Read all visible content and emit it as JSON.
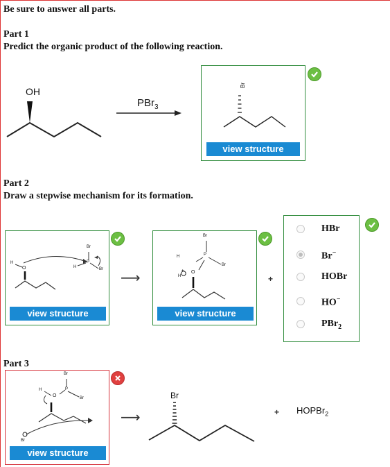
{
  "instruction": "Be sure to answer all parts.",
  "part1": {
    "heading": "Part 1",
    "prompt": "Predict the organic product of the following reaction.",
    "reactant_label": "OH",
    "reagent_prefix": "PBr",
    "reagent_sub": "3",
    "answer_atom_label": "Br",
    "button": "view structure",
    "status": "correct"
  },
  "part2": {
    "heading": "Part 2",
    "prompt": "Draw a stepwise mechanism for its formation.",
    "step1": {
      "button": "view structure",
      "status": "correct",
      "labels": {
        "h": "H",
        "o": "O",
        "br": "Br",
        "p": "P",
        "br2": "Br",
        "h2": "H"
      }
    },
    "step2": {
      "button": "view structure",
      "status": "correct",
      "labels": {
        "br_top": "Br",
        "h": "H",
        "p": "P",
        "br": "Br",
        "o": "O",
        "h2": "H",
        "charge": "+"
      }
    },
    "plus": "+",
    "options": [
      {
        "label": "HBr",
        "sup": "",
        "sub": "",
        "selected": false
      },
      {
        "label": "Br",
        "sup": "−",
        "sub": "",
        "selected": true
      },
      {
        "label": "HOBr",
        "sup": "",
        "sub": "",
        "selected": false
      },
      {
        "label": "HO",
        "sup": "−",
        "sub": "",
        "selected": false
      },
      {
        "label": "PBr",
        "sup": "",
        "sub": "2",
        "selected": false
      }
    ],
    "options_status": "correct"
  },
  "part3": {
    "heading": "Part 3",
    "step": {
      "button": "view structure",
      "status": "incorrect",
      "labels": {
        "br_top": "Br",
        "h": "H",
        "o": "O",
        "p": "P",
        "br": "Br",
        "br_bottom": "Br"
      }
    },
    "product_label": "Br",
    "plus": "+",
    "byproduct_prefix": "HOPBr",
    "byproduct_sub": "2"
  },
  "colors": {
    "correct_border": "#2e8b3a",
    "incorrect_border": "#d6303a",
    "button_blue": "#1a8ad3",
    "check_green": "#6cbf43",
    "cross_red": "#e0403f"
  },
  "icons": [
    "checkmark-icon",
    "cross-icon",
    "reaction-arrow-icon",
    "radio-icon"
  ]
}
